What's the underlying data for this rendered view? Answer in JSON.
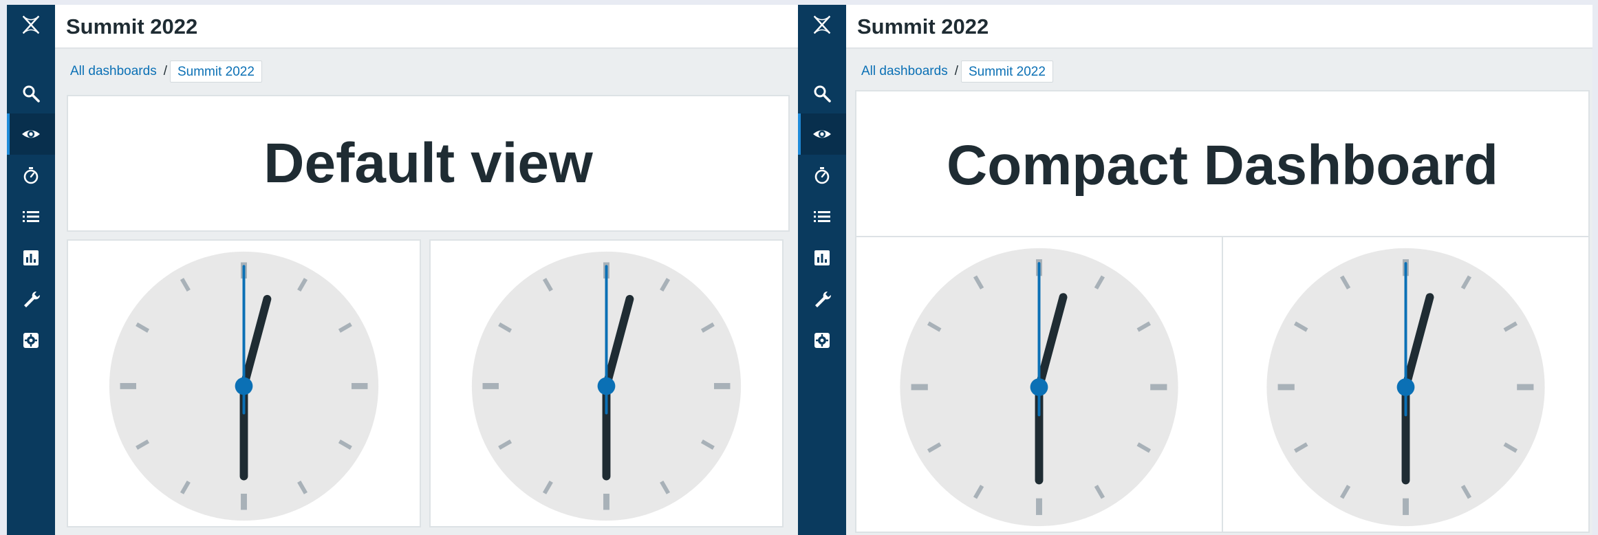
{
  "colors": {
    "rail": "#0a3a5e",
    "accent": "#0b70b5",
    "clock_face": "#e8e8e8",
    "tick": "#a8b1b8",
    "hand": "#1f2c33"
  },
  "sidebar": {
    "logo_icon": "zabbix-x-logo-icon",
    "items": [
      {
        "icon": "search-icon",
        "label": "Search"
      },
      {
        "icon": "eye-icon",
        "label": "Monitoring",
        "active": true
      },
      {
        "icon": "stopwatch-icon",
        "label": "Services"
      },
      {
        "icon": "list-icon",
        "label": "Inventory"
      },
      {
        "icon": "bar-chart-icon",
        "label": "Reports"
      },
      {
        "icon": "wrench-icon",
        "label": "Data collection"
      },
      {
        "icon": "gear-icon",
        "label": "Administration"
      }
    ]
  },
  "panels": [
    {
      "app_title": "Summit 2022",
      "breadcrumb": [
        {
          "label": "All dashboards"
        },
        {
          "label": "Summit 2022"
        }
      ],
      "text_widget": "Default view",
      "clocks": [
        {
          "hours": 12,
          "minutes": 30
        },
        {
          "hours": 12,
          "minutes": 30
        }
      ]
    },
    {
      "app_title": "Summit 2022",
      "breadcrumb": [
        {
          "label": "All dashboards"
        },
        {
          "label": "Summit 2022"
        }
      ],
      "text_widget": "Compact Dashboard",
      "clocks": [
        {
          "hours": 12,
          "minutes": 30
        },
        {
          "hours": 12,
          "minutes": 30
        }
      ]
    }
  ]
}
